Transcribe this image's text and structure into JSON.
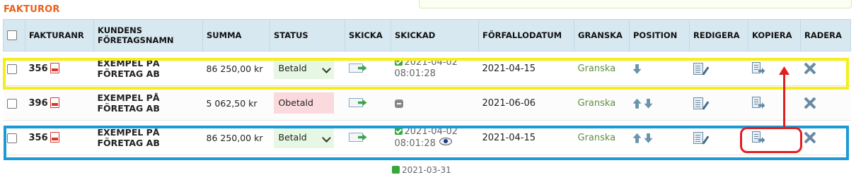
{
  "section_title": "FAKTUROR",
  "columns": {
    "invoice_no": "FAKTURANR",
    "customer": "KUNDENS FÖRETAGSNAMN",
    "amount": "SUMMA",
    "status": "STATUS",
    "send": "SKICKA",
    "sent": "SKICKAD",
    "due_date": "FÖRFALLODATUM",
    "review": "GRANSKA",
    "position": "POSITION",
    "edit": "REDIGERA",
    "copy": "KOPIERA",
    "delete": "RADERA"
  },
  "rows": [
    {
      "invoice_no": "356",
      "customer_line1": "EXEMPEL PÅ",
      "customer_line2": "FÖRETAG AB",
      "amount": "86 250,00 kr",
      "status": "Betald",
      "sent_date": "2021-04-02",
      "sent_time": "08:01:28",
      "due_date": "2021-04-15",
      "review": "Granska",
      "highlight": "yellow"
    },
    {
      "invoice_no": "396",
      "customer_line1": "EXEMPEL PÅ",
      "customer_line2": "FÖRETAG AB",
      "amount": "5 062,50 kr",
      "status": "Obetald",
      "sent_date": "",
      "sent_time": "",
      "due_date": "2021-06-06",
      "review": "Granska",
      "highlight": ""
    },
    {
      "invoice_no": "356",
      "customer_line1": "EXEMPEL PÅ",
      "customer_line2": "FÖRETAG AB",
      "amount": "86 250,00 kr",
      "status": "Betald",
      "sent_date": "2021-04-02",
      "sent_time": "08:01:28",
      "due_date": "2021-04-15",
      "review": "Granska",
      "highlight": "blue"
    }
  ],
  "partial_next_row": "2021-03-31",
  "colors": {
    "title": "#e8601c",
    "header_bg": "#d7e8f1",
    "paid_bg": "#e6f7e3",
    "unpaid_bg": "#fadadd",
    "review": "#5e8f3d",
    "highlight_yellow": "#f5ee1a",
    "highlight_blue": "#1b9ad6",
    "annotation_red": "#e02020"
  },
  "icons": {
    "pdf": "pdf-icon",
    "send": "send-envelope-icon",
    "sent_ok": "check-icon",
    "not_sent": "pending-icon",
    "viewed": "eye-icon",
    "position_up": "arrow-up-icon",
    "position_down": "arrow-down-icon",
    "edit": "edit-icon",
    "copy": "copy-icon",
    "delete": "delete-icon"
  }
}
